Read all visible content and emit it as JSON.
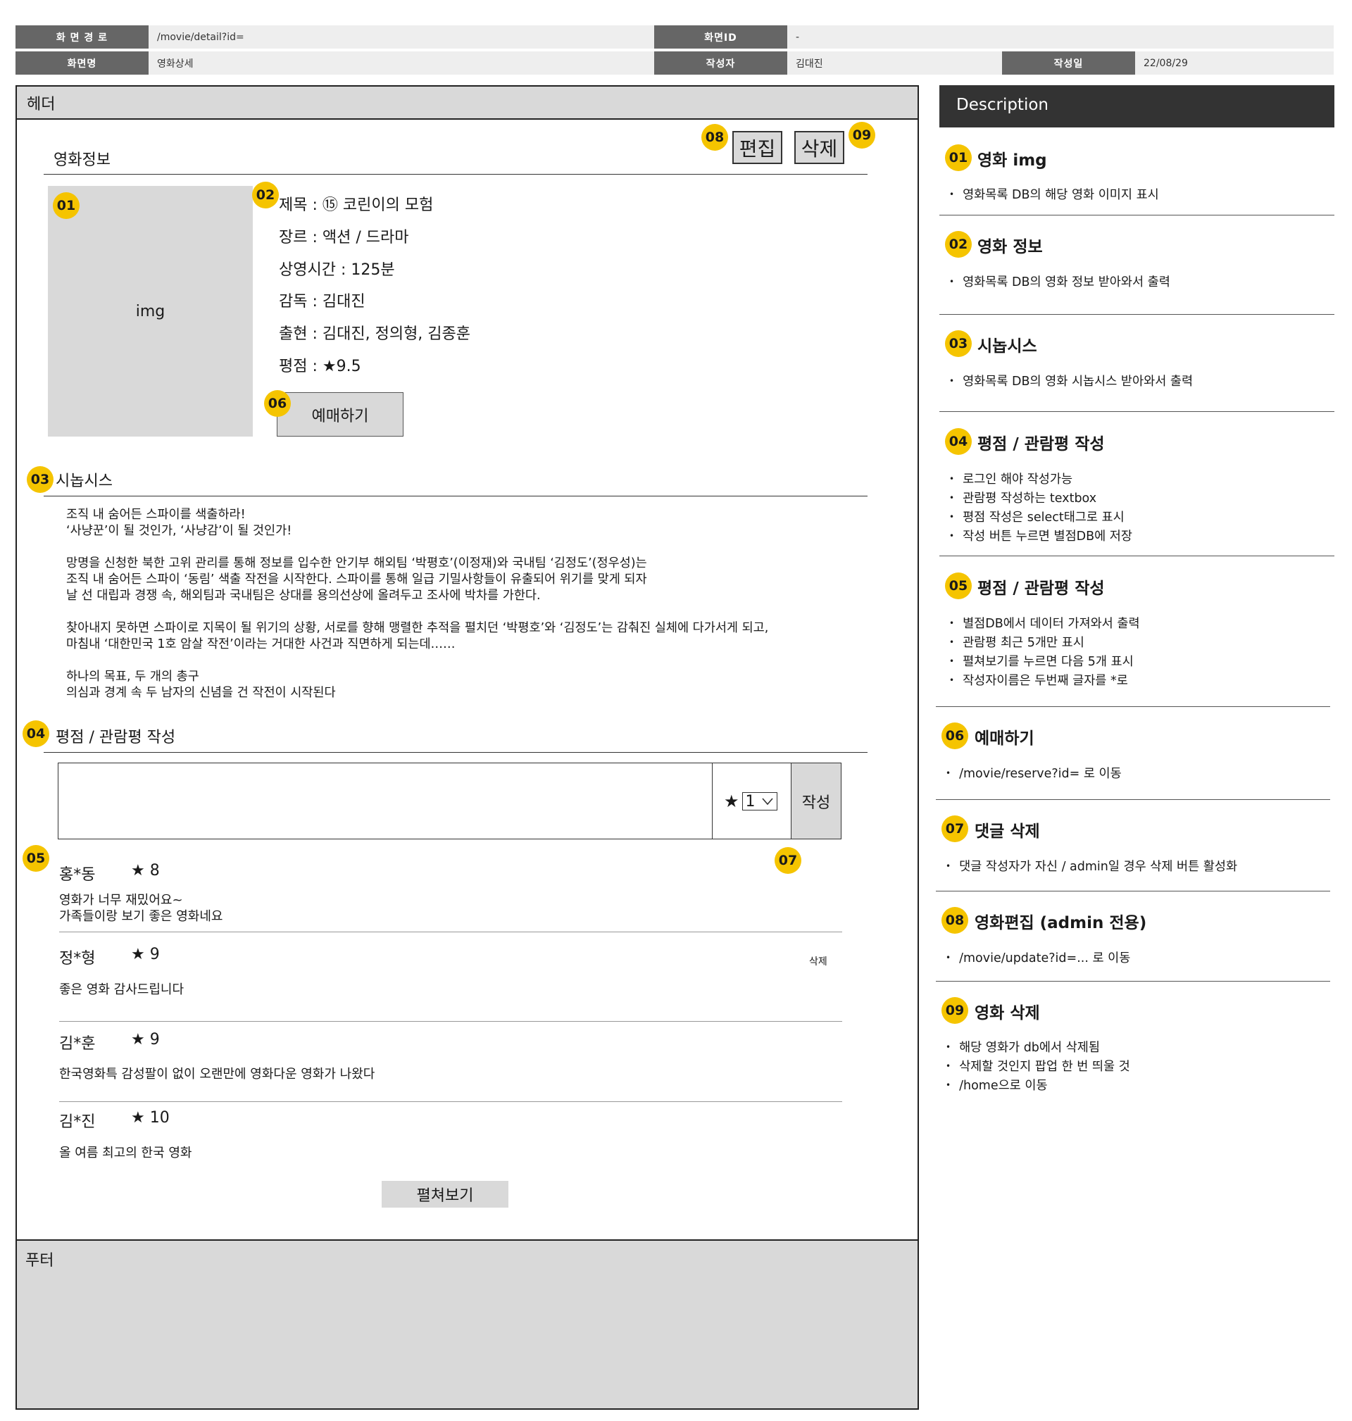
{
  "spec": {
    "route_label": "화 면 경 로",
    "route_value": "/movie/detail?id=",
    "screen_id_label": "화면ID",
    "screen_id_value": "-",
    "screen_name_label": "화면명",
    "screen_name_value": "영화상세",
    "author_label": "작성자",
    "author_value": "김대진",
    "date_label": "작성일",
    "date_value": "22/08/29"
  },
  "wireframe": {
    "header": "헤더",
    "footer": "푸터",
    "edit_button": "편집",
    "delete_button": "삭제",
    "movie_info_title": "영화정보",
    "poster_placeholder": "img",
    "info": {
      "title": "제목 : ⑮ 코린이의 모험",
      "genre": "장르 : 액션 / 드라마",
      "runtime": "상영시간 : 125분",
      "director": "감독 : 김대진",
      "cast": "출현 : 김대진, 정의형, 김종훈",
      "rating": "평점 : ★9.5"
    },
    "reserve_button": "예매하기",
    "synopsis_title": "시놉시스",
    "synopsis": [
      "조직 내 숨어든 스파이를 색출하라!\n‘사냥꾼’이 될 것인가, ‘사냥감’이 될 것인가!",
      "망명을 신청한 북한 고위 관리를 통해 정보를 입수한 안기부 해외팀 ‘박평호’(이정재)와 국내팀 ‘김정도’(정우성)는\n조직 내 숨어든 스파이 ‘동림’ 색출 작전을 시작한다. 스파이를 통해 일급 기밀사항들이 유출되어 위기를 맞게 되자\n날 선 대립과 경쟁 속, 해외팀과 국내팀은 상대를 용의선상에 올려두고 조사에 박차를 가한다.",
      "찾아내지 못하면 스파이로 지목이 될 위기의 상황, 서로를 향해 맹렬한 추적을 펼치던 ‘박평호’와 ‘김정도’는 감춰진 실체에 다가서게 되고,\n마침내 ‘대한민국 1호 암살 작전’이라는 거대한 사건과 직면하게 되는데……",
      "하나의 목표, 두 개의 총구\n의심과 경계 속 두 남자의 신념을 건 작전이 시작된다"
    ],
    "review_title": "평점 / 관람평 작성",
    "star_symbol": "★",
    "select_value": "1",
    "write_button": "작성",
    "comment_delete": "삭제",
    "reviews": [
      {
        "name": "홍*동",
        "score": "★ 8",
        "text": "영화가 너무 재밌어요~\n가족들이랑 보기 좋은 영화네요"
      },
      {
        "name": "정*형",
        "score": "★ 9",
        "text": "좋은 영화 감사드립니다"
      },
      {
        "name": "김*훈",
        "score": "★ 9",
        "text": "한국영화특 감성팔이 없이 오랜만에 영화다운 영화가 나왔다"
      },
      {
        "name": "김*진",
        "score": "★ 10",
        "text": "올 여름 최고의 한국 영화"
      }
    ],
    "more_button": "펼쳐보기"
  },
  "badges": [
    "01",
    "02",
    "03",
    "04",
    "05",
    "06",
    "07",
    "08",
    "09"
  ],
  "badge_color": "#f5c400",
  "description": {
    "heading": "Description",
    "items": [
      {
        "num": "01",
        "title": "영화 img",
        "bullets": [
          "영화목록 DB의 해당 영화 이미지 표시"
        ]
      },
      {
        "num": "02",
        "title": "영화 정보",
        "bullets": [
          "영화목록 DB의 영화 정보 받아와서 출력"
        ]
      },
      {
        "num": "03",
        "title": "시놉시스",
        "bullets": [
          "영화목록 DB의 영화 시놉시스 받아와서 출력"
        ]
      },
      {
        "num": "04",
        "title": "평점 / 관람평 작성",
        "bullets": [
          "로그인 해야 작성가능",
          "관람평 작성하는 textbox",
          "평점 작성은 select태그로 표시",
          "작성 버튼 누르면 별점DB에 저장"
        ]
      },
      {
        "num": "05",
        "title": "평점 / 관람평 작성",
        "bullets": [
          "별점DB에서 데이터 가져와서 출력",
          "관람평 최근 5개만 표시",
          "펼쳐보기를 누르면 다음 5개 표시",
          "작성자이름은 두번째 글자를 *로"
        ]
      },
      {
        "num": "06",
        "title": "예매하기",
        "bullets": [
          "/movie/reserve?id= 로 이동"
        ]
      },
      {
        "num": "07",
        "title": "댓글 삭제",
        "bullets": [
          "댓글 작성자가 자신 / admin일 경우 삭제 버튼 활성화"
        ]
      },
      {
        "num": "08",
        "title": "영화편집 (admin 전용)",
        "bullets": [
          "/movie/update?id=... 로 이동"
        ]
      },
      {
        "num": "09",
        "title": "영화 삭제",
        "bullets": [
          "해당 영화가 db에서 삭제됨",
          "삭제할 것인지 팝업 한 번 띄울 것",
          "/home으로 이동"
        ]
      }
    ]
  }
}
